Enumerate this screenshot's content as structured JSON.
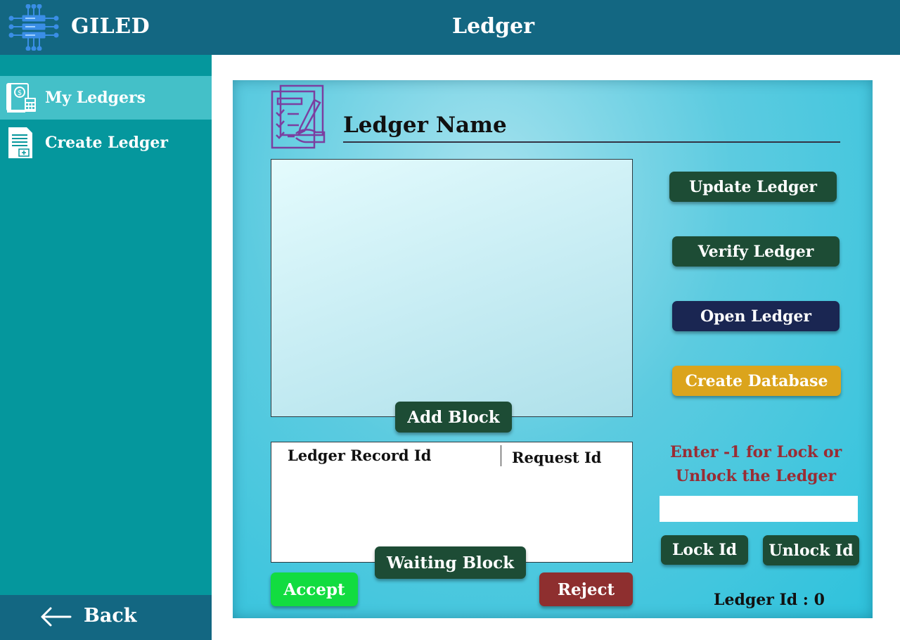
{
  "header": {
    "app_name": "GILED",
    "page_title": "Ledger"
  },
  "sidebar": {
    "items": [
      {
        "label": "My Ledgers",
        "icon": "ledger-calculator-icon",
        "active": true
      },
      {
        "label": "Create Ledger",
        "icon": "document-add-icon",
        "active": false
      }
    ],
    "back_label": "Back"
  },
  "main": {
    "ledger_name_label": "Ledger Name",
    "add_block_label": "Add Block",
    "table": {
      "columns": [
        "Ledger Record Id",
        "Request Id"
      ],
      "rows": []
    },
    "waiting_block_label": "Waiting Block",
    "accept_label": "Accept",
    "reject_label": "Reject",
    "actions": {
      "update_label": "Update Ledger",
      "verify_label": "Verify Ledger",
      "open_label": "Open Ledger",
      "create_db_label": "Create Database"
    },
    "lock": {
      "message_line1": "Enter -1 for Lock or",
      "message_line2": "Unlock the Ledger",
      "input_value": "",
      "lock_label": "Lock Id",
      "unlock_label": "Unlock Id"
    },
    "ledger_id_text": "Ledger Id : 0"
  },
  "colors": {
    "header": "#136782",
    "sidebar": "#05979d",
    "sidebar_active": "#44c0c8",
    "button_dark": "#1d4c35",
    "button_open": "#1a2652",
    "button_create": "#dba41c",
    "accept": "#12dc40",
    "reject": "#8e2f2f",
    "lock_message": "#992c34"
  }
}
